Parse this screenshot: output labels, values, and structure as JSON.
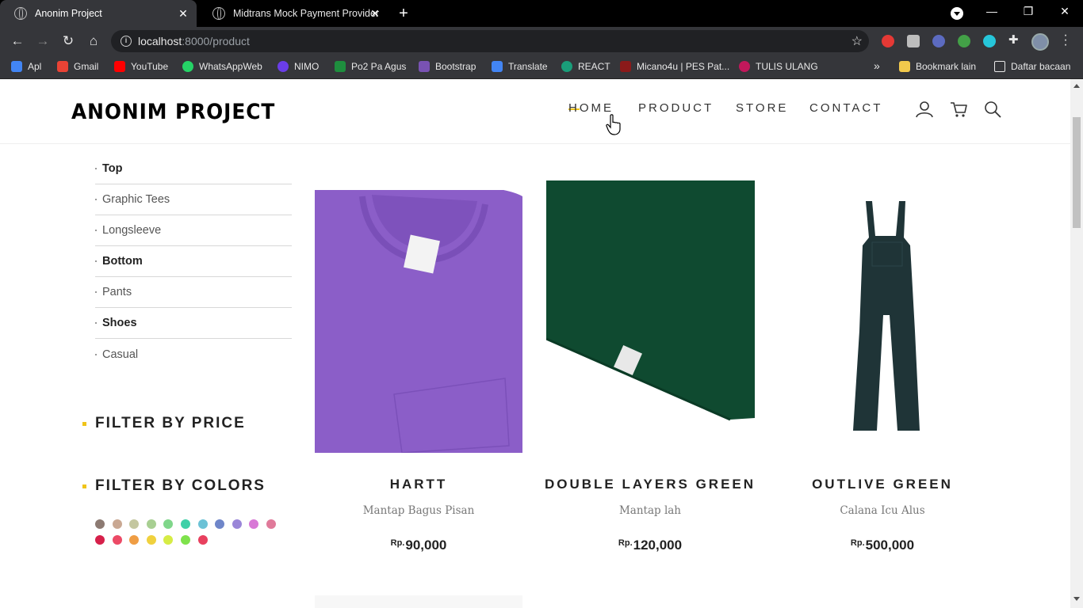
{
  "browser": {
    "tabs": [
      {
        "title": "Anonim Project",
        "active": true
      },
      {
        "title": "Midtrans Mock Payment Provider",
        "active": false
      }
    ],
    "address": {
      "host": "localhost",
      "rest": ":8000/product"
    },
    "bookmarks": [
      {
        "label": "Apl",
        "icon": "apps-grid-icon",
        "color": "#4285f4"
      },
      {
        "label": "Gmail",
        "icon": "gmail-icon",
        "color": "#ea4335"
      },
      {
        "label": "YouTube",
        "icon": "youtube-icon",
        "color": "#ff0000"
      },
      {
        "label": "WhatsAppWeb",
        "icon": "whatsapp-icon",
        "color": "#25d366"
      },
      {
        "label": "NIMO",
        "icon": "nimo-icon",
        "color": "#6a3de8"
      },
      {
        "label": "Po2 Pa Agus",
        "icon": "classroom-icon",
        "color": "#1e8e3e"
      },
      {
        "label": "Bootstrap",
        "icon": "bootstrap-icon",
        "color": "#7952b3"
      },
      {
        "label": "Translate",
        "icon": "translate-icon",
        "color": "#4285f4"
      },
      {
        "label": "REACT",
        "icon": "react-icon",
        "color": "#1a9e7a"
      },
      {
        "label": "Micano4u | PES Pat...",
        "icon": "micano-icon",
        "color": "#8b1a1a"
      },
      {
        "label": "TULIS ULANG",
        "icon": "tulis-icon",
        "color": "#c2185b"
      }
    ],
    "bookmarks_right": [
      {
        "label": "Bookmark lain",
        "icon": "folder-icon"
      },
      {
        "label": "Daftar bacaan",
        "icon": "reading-list-icon"
      }
    ]
  },
  "site": {
    "logo": "ANONIM PROJECT",
    "nav": [
      "HOME",
      "PRODUCT",
      "STORE",
      "CONTACT"
    ]
  },
  "categories": [
    {
      "label": "Top",
      "bold": true
    },
    {
      "label": "Graphic Tees",
      "bold": false
    },
    {
      "label": "Longsleeve",
      "bold": false
    },
    {
      "label": "Bottom",
      "bold": true
    },
    {
      "label": "Pants",
      "bold": false
    },
    {
      "label": "Shoes",
      "bold": true
    },
    {
      "label": "Casual",
      "bold": false
    }
  ],
  "filters": {
    "price_title": "FILTER BY PRICE",
    "colors_title": "FILTER BY COLORS",
    "colors": [
      "#8c7a72",
      "#c9a893",
      "#c4c7a0",
      "#a8cf92",
      "#7fd68a",
      "#3fd0a8",
      "#6cc2d6",
      "#6f86c9",
      "#9a86d8",
      "#d878d6",
      "#e07a9a",
      "#d6204a",
      "#ec4a66",
      "#ef9d44",
      "#f0d13e",
      "#d6ec45",
      "#7fe24c",
      "#e8405e"
    ]
  },
  "products": [
    {
      "name": "HARTT",
      "desc": "Mantap Bagus Pisan",
      "currency": "Rp.",
      "price": "90,000",
      "color": "#8a5fc7"
    },
    {
      "name": "DOUBLE LAYERS GREEN",
      "desc": "Mantap lah",
      "currency": "Rp.",
      "price": "120,000",
      "color": "#104a32"
    },
    {
      "name": "OUTLIVE GREEN",
      "desc": "Calana Icu Alus",
      "currency": "Rp.",
      "price": "500,000",
      "color": "#1f3437"
    }
  ]
}
